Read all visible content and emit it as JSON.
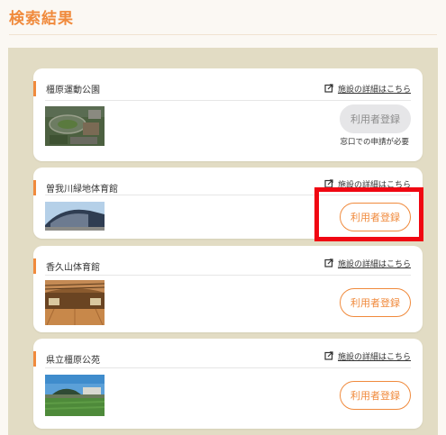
{
  "page_title": "検索結果",
  "facilities": [
    {
      "name": "橿原運動公園",
      "detail_link": "施設の詳細はこちら",
      "register_label": "利用者登録",
      "register_enabled": false,
      "note": "窓口での申請が必要",
      "icon": "external-link-icon"
    },
    {
      "name": "曽我川緑地体育館",
      "detail_link": "施設の詳細はこちら",
      "register_label": "利用者登録",
      "register_enabled": true,
      "highlighted": true,
      "icon": "external-link-icon"
    },
    {
      "name": "香久山体育館",
      "detail_link": "施設の詳細はこちら",
      "register_label": "利用者登録",
      "register_enabled": true,
      "icon": "external-link-icon"
    },
    {
      "name": "県立橿原公苑",
      "detail_link": "施設の詳細はこちら",
      "register_label": "利用者登録",
      "register_enabled": true,
      "icon": "external-link-icon"
    }
  ],
  "colors": {
    "accent": "#f08a3c",
    "panel_bg": "#e2dcc4",
    "highlight": "#f00712",
    "disabled_button": "#e6e6e8"
  }
}
